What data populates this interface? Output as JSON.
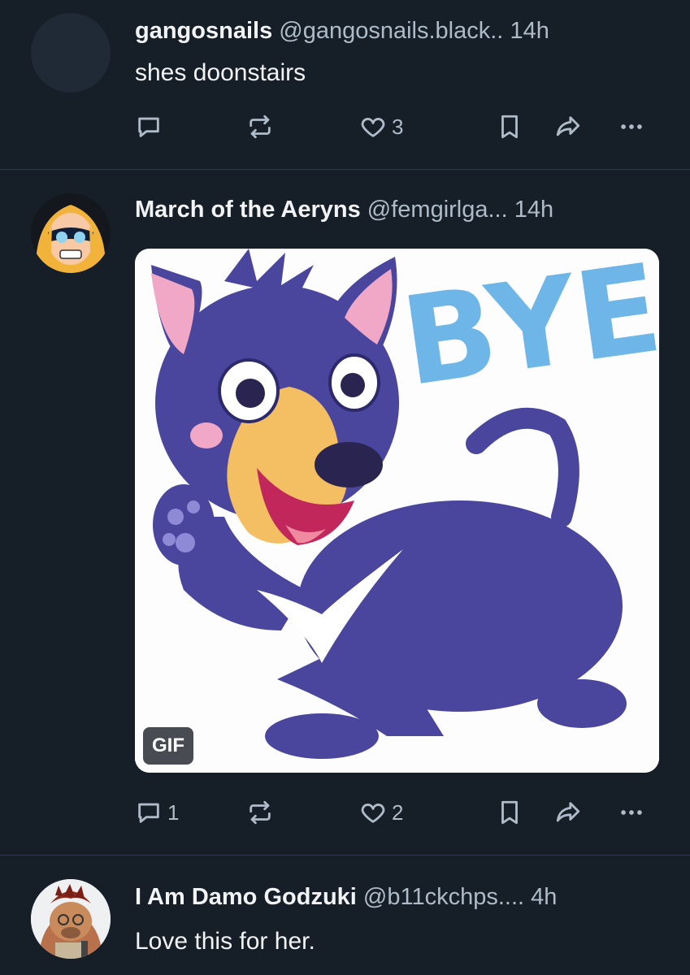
{
  "posts": [
    {
      "author_name": "gangosnails",
      "handle": "@gangosnails.black..",
      "time": "14h",
      "text": "shes doonstairs",
      "actions": {
        "reply_count": "",
        "repost_count": "",
        "like_count": "3"
      }
    },
    {
      "author_name": "March of the Aeryns",
      "handle": "@femgirlga...",
      "time": "14h",
      "media": {
        "overlay_text": "BYE!",
        "badge": "GIF"
      },
      "actions": {
        "reply_count": "1",
        "repost_count": "",
        "like_count": "2"
      }
    },
    {
      "author_name": "I Am Damo Godzuki",
      "handle": "@b11ckchps....",
      "time": "4h",
      "text": "Love this for her."
    }
  ],
  "icons": {
    "reply": "reply-icon",
    "repost": "repost-icon",
    "like": "heart-icon",
    "bookmark": "bookmark-icon",
    "share": "share-icon",
    "more": "more-icon"
  },
  "colors": {
    "background": "#161e27",
    "text_primary": "#f1f3f5",
    "text_secondary": "#aebbc9",
    "divider": "#2c3a49"
  }
}
